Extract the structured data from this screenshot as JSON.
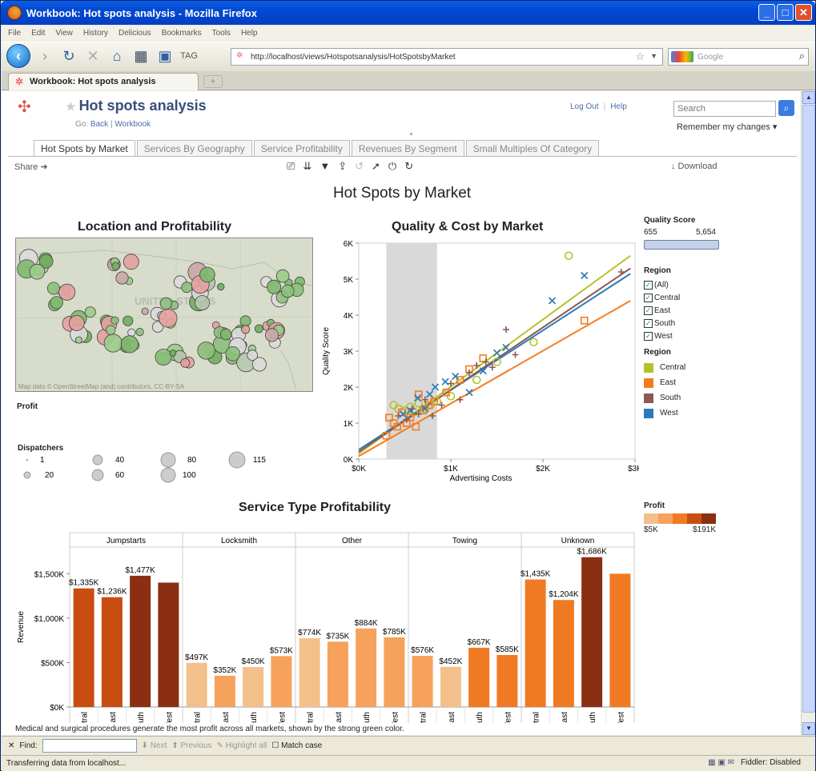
{
  "window": {
    "title": "Workbook: Hot spots analysis - Mozilla Firefox"
  },
  "menu": [
    "File",
    "Edit",
    "View",
    "History",
    "Delicious",
    "Bookmarks",
    "Tools",
    "Help"
  ],
  "address": {
    "url": "http://localhost/views/Hotspotsanalysis/HotSpotsbyMarket",
    "search_placeholder": "Google"
  },
  "browser_tab": {
    "label": "Workbook: Hot spots analysis"
  },
  "workbook": {
    "title": "Hot spots analysis",
    "go_label": "Go:",
    "back": "Back",
    "workbook_link": "Workbook",
    "logout": "Log Out",
    "help": "Help",
    "search_placeholder": "Search",
    "remember": "Remember my changes ▾"
  },
  "view_tabs": [
    "Hot Spots by Market",
    "Services By Geography",
    "Service Profitability",
    "Revenues By Segment",
    "Small Multiples Of Category"
  ],
  "toolbar": {
    "share": "Share ➜",
    "download": "↓ Download"
  },
  "dashboard": {
    "title": "Hot Spots by Market",
    "map_title": "Location and Profitability",
    "map_credit": "Map data © OpenStreetMap (and) contributors, CC-BY-SA",
    "map_label": "UNITED STATES",
    "profit_label": "Profit",
    "dispatchers": {
      "title": "Dispatchers",
      "values": [
        "1",
        "40",
        "80",
        "115",
        "20",
        "60",
        "100"
      ]
    },
    "scatter_title": "Quality & Cost by Market",
    "bar_title": "Service Type Profitability",
    "caption": "Medical and surgical procedures generate the most profit across all markets, shown by the strong green color."
  },
  "filters": {
    "quality_title": "Quality Score",
    "quality_min": "655",
    "quality_max": "5,654",
    "region_title": "Region",
    "region_items": [
      "(All)",
      "Central",
      "East",
      "South",
      "West"
    ],
    "region_legend_title": "Region",
    "region_legend": [
      {
        "name": "Central",
        "color": "#b4c22a"
      },
      {
        "name": "East",
        "color": "#f47c20"
      },
      {
        "name": "South",
        "color": "#8b5a50"
      },
      {
        "name": "West",
        "color": "#2b7bba"
      }
    ],
    "profit_title": "Profit",
    "profit_min": "$5K",
    "profit_max": "$191K",
    "profit_colors": [
      "#f3c08b",
      "#f6a25c",
      "#f07a24",
      "#c94d10",
      "#8a2f12"
    ]
  },
  "chart_data": [
    {
      "type": "scatter",
      "title": "Quality & Cost by Market",
      "xlabel": "Advertising Costs",
      "ylabel": "Quality Score",
      "xticks": [
        "$0K",
        "$1K",
        "$2K",
        "$3K"
      ],
      "yticks": [
        "0K",
        "1K",
        "2K",
        "3K",
        "4K",
        "5K",
        "6K"
      ],
      "xlim": [
        0,
        3000
      ],
      "ylim": [
        0,
        6000
      ],
      "highlight_band": [
        300,
        850
      ],
      "trend_lines": [
        {
          "name": "Central",
          "from": [
            0,
            150
          ],
          "to": [
            2950,
            5650
          ]
        },
        {
          "name": "West",
          "from": [
            0,
            260
          ],
          "to": [
            2950,
            5150
          ]
        },
        {
          "name": "South",
          "from": [
            0,
            200
          ],
          "to": [
            2950,
            5300
          ]
        },
        {
          "name": "East",
          "from": [
            0,
            80
          ],
          "to": [
            2950,
            4400
          ]
        }
      ],
      "series": [
        {
          "name": "Central",
          "marker": "circle",
          "points": [
            [
              380,
              1500
            ],
            [
              430,
              1400
            ],
            [
              500,
              1350
            ],
            [
              560,
              1450
            ],
            [
              600,
              1300
            ],
            [
              650,
              1550
            ],
            [
              720,
              1400
            ],
            [
              780,
              1500
            ],
            [
              850,
              1600
            ],
            [
              1000,
              1750
            ],
            [
              1280,
              2200
            ],
            [
              1500,
              2700
            ],
            [
              1900,
              3250
            ],
            [
              2280,
              5650
            ]
          ]
        },
        {
          "name": "East",
          "marker": "square",
          "points": [
            [
              300,
              650
            ],
            [
              330,
              1150
            ],
            [
              380,
              1000
            ],
            [
              420,
              900
            ],
            [
              470,
              1300
            ],
            [
              520,
              1000
            ],
            [
              560,
              1150
            ],
            [
              620,
              900
            ],
            [
              650,
              1800
            ],
            [
              700,
              1350
            ],
            [
              760,
              1500
            ],
            [
              820,
              1600
            ],
            [
              950,
              1850
            ],
            [
              1100,
              2200
            ],
            [
              1200,
              2500
            ],
            [
              1350,
              2800
            ],
            [
              2450,
              3850
            ]
          ]
        },
        {
          "name": "South",
          "marker": "plus",
          "points": [
            [
              430,
              1200
            ],
            [
              520,
              1100
            ],
            [
              580,
              1400
            ],
            [
              650,
              1250
            ],
            [
              720,
              1650
            ],
            [
              800,
              1200
            ],
            [
              900,
              1500
            ],
            [
              1000,
              2100
            ],
            [
              1100,
              1650
            ],
            [
              1200,
              2400
            ],
            [
              1280,
              2600
            ],
            [
              1380,
              2700
            ],
            [
              1450,
              2550
            ],
            [
              1600,
              3600
            ],
            [
              1700,
              2900
            ],
            [
              2850,
              5200
            ]
          ]
        },
        {
          "name": "West",
          "marker": "x",
          "points": [
            [
              480,
              1250
            ],
            [
              560,
              1350
            ],
            [
              640,
              1700
            ],
            [
              720,
              1400
            ],
            [
              770,
              1800
            ],
            [
              830,
              2000
            ],
            [
              940,
              2150
            ],
            [
              1050,
              2300
            ],
            [
              1200,
              1850
            ],
            [
              1350,
              2450
            ],
            [
              1500,
              2950
            ],
            [
              1600,
              3100
            ],
            [
              2100,
              4400
            ],
            [
              2450,
              5100
            ]
          ]
        }
      ]
    },
    {
      "type": "bar",
      "title": "Service Type Profitability",
      "ylabel": "Revenue",
      "yticks": [
        "$0K",
        "$500K",
        "$1,000K",
        "$1,500K"
      ],
      "ylim": [
        0,
        1800
      ],
      "categories": [
        "Central",
        "East",
        "South",
        "West"
      ],
      "panels": [
        {
          "name": "Jumpstarts",
          "values": [
            1335,
            1236,
            1477,
            1400
          ],
          "labels": [
            "$1,335K",
            "$1,236K",
            "$1,477K",
            ""
          ],
          "color_level": [
            3,
            3,
            4,
            4
          ]
        },
        {
          "name": "Locksmith",
          "values": [
            497,
            352,
            450,
            573
          ],
          "labels": [
            "$497K",
            "$352K",
            "$450K",
            "$573K"
          ],
          "color_level": [
            0,
            1,
            0,
            1
          ]
        },
        {
          "name": "Other",
          "values": [
            774,
            735,
            884,
            785
          ],
          "labels": [
            "$774K",
            "$735K",
            "$884K",
            "$785K"
          ],
          "color_level": [
            0,
            1,
            1,
            1
          ]
        },
        {
          "name": "Towing",
          "values": [
            576,
            452,
            667,
            585
          ],
          "labels": [
            "$576K",
            "$452K",
            "$667K",
            "$585K"
          ],
          "color_level": [
            1,
            0,
            2,
            2
          ]
        },
        {
          "name": "Unknown",
          "values": [
            1435,
            1204,
            1686,
            1500
          ],
          "labels": [
            "$1,435K",
            "$1,204K",
            "$1,686K",
            ""
          ],
          "color_level": [
            2,
            2,
            4,
            2
          ]
        }
      ]
    }
  ],
  "findbar": {
    "close": "✕",
    "label": "Find:",
    "next": "Next",
    "previous": "Previous",
    "highlight": "Highlight all",
    "match": "Match case"
  },
  "status": {
    "text": "Transferring data from localhost...",
    "fiddler": "Fiddler: Disabled"
  }
}
